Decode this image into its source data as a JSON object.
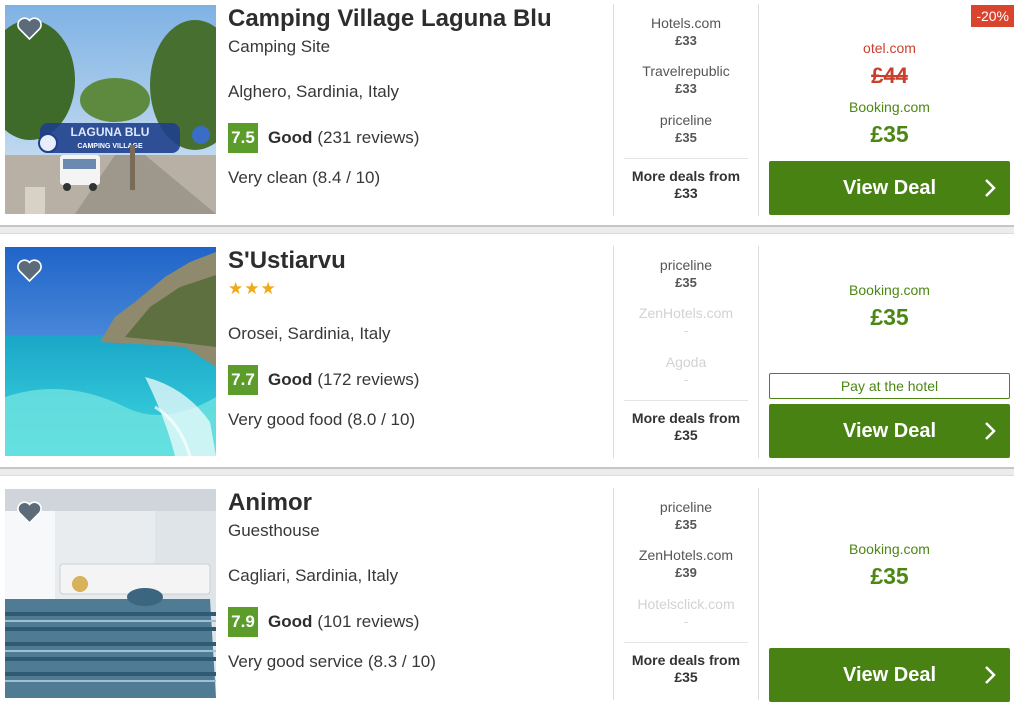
{
  "listings": [
    {
      "name": "Camping Village Laguna Blu",
      "subtitle": "Camping Site",
      "location": "Alghero, Sardinia, Italy",
      "score": "7.5",
      "rating_label": "Good",
      "reviews": "(231 reviews)",
      "highlight": "Very clean (8.4 / 10)",
      "photo_sign": "LAGUNA BLU",
      "photo_sign_sub": "CAMPING VILLAGE",
      "deals": [
        {
          "site": "Hotels.com",
          "price": "£33"
        },
        {
          "site": "Travelrepublic",
          "price": "£33"
        },
        {
          "site": "priceline",
          "price": "£35"
        }
      ],
      "more_label": "More deals from",
      "more_price": "£33",
      "discount_badge": "-20%",
      "old_site": "otel.com",
      "old_price": "£44",
      "best_site": "Booking.com",
      "best_price": "£35",
      "button_label": "View Deal"
    },
    {
      "name": "S'Ustiarvu",
      "stars": "★★★",
      "location": "Orosei, Sardinia, Italy",
      "score": "7.7",
      "rating_label": "Good",
      "reviews": "(172 reviews)",
      "highlight": "Very good food (8.0 / 10)",
      "deals": [
        {
          "site": "priceline",
          "price": "£35"
        },
        {
          "site": "ZenHotels.com",
          "price": "-"
        },
        {
          "site": "Agoda",
          "price": "-"
        }
      ],
      "more_label": "More deals from",
      "more_price": "£35",
      "best_site": "Booking.com",
      "best_price": "£35",
      "pay_at_hotel": "Pay at the hotel",
      "button_label": "View Deal"
    },
    {
      "name": "Animor",
      "subtitle": "Guesthouse",
      "location": "Cagliari, Sardinia, Italy",
      "score": "7.9",
      "rating_label": "Good",
      "reviews": "(101 reviews)",
      "highlight": "Very good service (8.3 / 10)",
      "deals": [
        {
          "site": "priceline",
          "price": "£35"
        },
        {
          "site": "ZenHotels.com",
          "price": "£39"
        },
        {
          "site": "Hotelsclick.com",
          "price": "-"
        }
      ],
      "more_label": "More deals from",
      "more_price": "£35",
      "best_site": "Booking.com",
      "best_price": "£35",
      "button_label": "View Deal"
    }
  ],
  "colors": {
    "deal_green": "#478213",
    "price_green": "#4c8714",
    "rating_green": "#5b9c2a",
    "strike_red": "#c9402e",
    "star_gold": "#f2a918"
  }
}
